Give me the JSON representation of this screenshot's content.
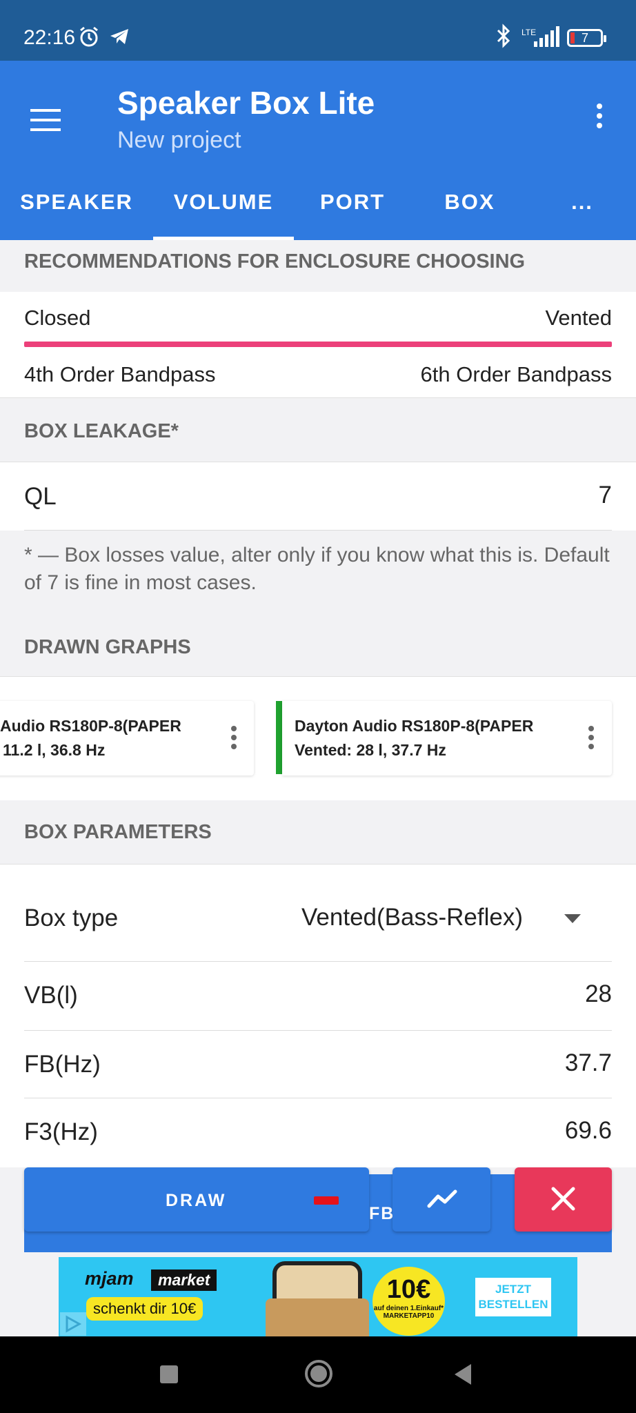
{
  "status_bar": {
    "time": "22:16",
    "network": "LTE",
    "battery": "7"
  },
  "app_bar": {
    "title": "Speaker Box Lite",
    "subtitle": "New project",
    "tabs": [
      {
        "label": "SPEAKER",
        "active": false
      },
      {
        "label": "VOLUME",
        "active": true
      },
      {
        "label": "PORT",
        "active": false
      },
      {
        "label": "BOX",
        "active": false
      },
      {
        "label": "...",
        "active": false
      }
    ]
  },
  "recommendations": {
    "header": "RECOMMENDATIONS FOR ENCLOSURE CHOOSING",
    "left_top": "Closed",
    "right_top": "Vented",
    "left_bottom": "4th Order Bandpass",
    "right_bottom": "6th Order Bandpass",
    "bar_color": "#ec407a"
  },
  "box_leakage": {
    "header": "BOX LEAKAGE*",
    "label": "QL",
    "value": "7",
    "note": "* — Box losses value, alter only if you know what this is. Default of 7 is fine in most cases."
  },
  "drawn_graphs": {
    "header": "DRAWN GRAPHS",
    "cards": [
      {
        "line1": "Audio RS180P-8(PAPER",
        "line2": "11.2 l, 36.8 Hz"
      },
      {
        "line1": "Dayton Audio RS180P-8(PAPER",
        "line2": "Vented: 28 l, 37.7 Hz",
        "marker_color": "#1fa22f"
      }
    ]
  },
  "box_parameters": {
    "header": "BOX PARAMETERS",
    "box_type_label": "Box type",
    "box_type_value": "Vented(Bass-Reflex)",
    "rows": [
      {
        "label": "VB(l)",
        "value": "28"
      },
      {
        "label": "FB(Hz)",
        "value": "37.7"
      },
      {
        "label": "F3(Hz)",
        "value": "69.6"
      }
    ]
  },
  "actions": {
    "draw_label": "DRAW",
    "partial_label": "FB",
    "primary_color": "#2f7ae0",
    "close_color": "#e8385a"
  },
  "ad": {
    "brand": "mjam",
    "brand_box": "market",
    "slogan": "schenkt dir 10€",
    "badge_big": "10€",
    "badge_small": "auf deinen 1.Einkauf* MARKETAPP10",
    "cta": "JETZT BESTELLEN"
  }
}
